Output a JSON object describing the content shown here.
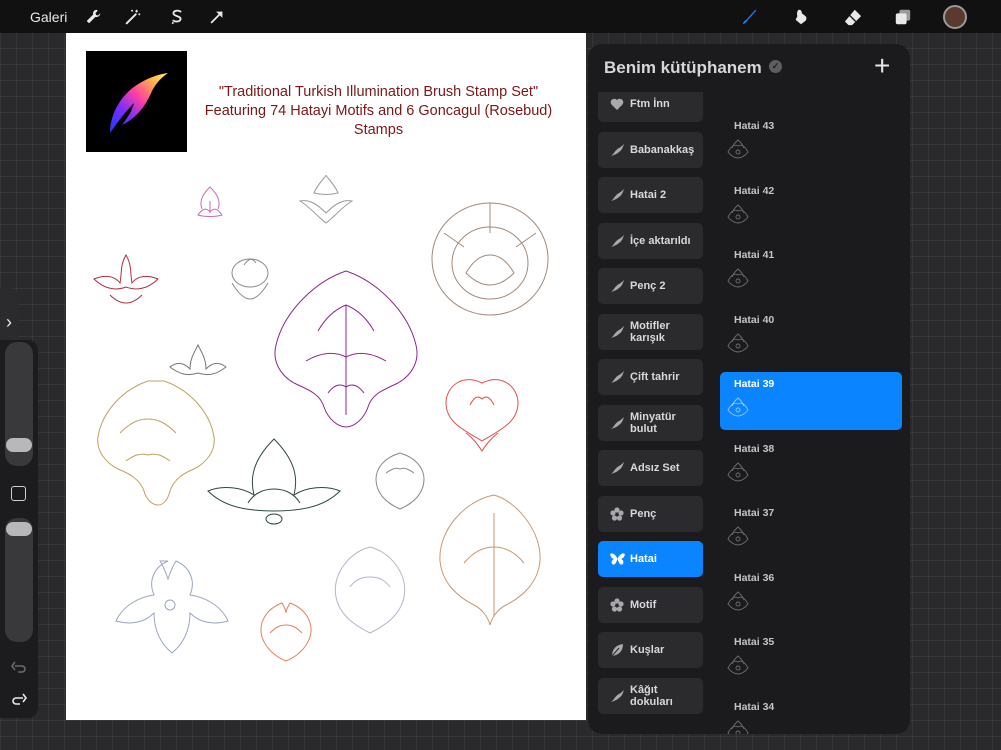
{
  "topbar": {
    "gallery_label": "Galeri",
    "left_tools": [
      "wrench-icon",
      "magic-wand-icon",
      "selection-icon",
      "transform-arrow-icon"
    ],
    "right_tools": [
      "brush-icon",
      "smudge-icon",
      "eraser-icon",
      "layers-icon"
    ],
    "current_color": "#5a3a2e",
    "active_tool_color": "#0a84ff"
  },
  "canvas": {
    "title": "\"Traditional Turkish Illumination Brush Stamp Set\" Featuring 74 Hatayi Motifs and 6 Goncagul (Rosebud) Stamps",
    "title_color": "#7b1717"
  },
  "library": {
    "title": "Benim kütüphanem",
    "add_label": "+",
    "brush_sets": [
      {
        "label": "Ftm İnn",
        "icon": "heart-icon",
        "selected": false
      },
      {
        "label": "Babanakkaş",
        "icon": "brush-stroke-icon",
        "selected": false
      },
      {
        "label": "Hatai 2",
        "icon": "brush-stroke-icon",
        "selected": false
      },
      {
        "label": "İçe aktarıldı",
        "icon": "brush-stroke-icon",
        "selected": false
      },
      {
        "label": "Penç 2",
        "icon": "brush-stroke-icon",
        "selected": false
      },
      {
        "label": "Motifler karışık",
        "icon": "brush-stroke-icon",
        "selected": false
      },
      {
        "label": "Çift tahrir",
        "icon": "brush-stroke-icon",
        "selected": false
      },
      {
        "label": "Minyatür bulut",
        "icon": "brush-stroke-icon",
        "selected": false
      },
      {
        "label": "Adsız Set",
        "icon": "brush-stroke-icon",
        "selected": false
      },
      {
        "label": "Penç",
        "icon": "flower-icon",
        "selected": false
      },
      {
        "label": "Hatai",
        "icon": "butterfly-icon",
        "selected": true
      },
      {
        "label": "Motif",
        "icon": "flower-icon",
        "selected": false
      },
      {
        "label": "Kuşlar",
        "icon": "leaf-icon",
        "selected": false
      },
      {
        "label": "Kâğıt dokuları",
        "icon": "brush-stroke-icon",
        "selected": false
      }
    ],
    "brushes": [
      {
        "label": "Hatai 43",
        "selected": false
      },
      {
        "label": "Hatai 42",
        "selected": false
      },
      {
        "label": "Hatai 41",
        "selected": false
      },
      {
        "label": "Hatai 40",
        "selected": false
      },
      {
        "label": "Hatai 39",
        "selected": true
      },
      {
        "label": "Hatai 38",
        "selected": false
      },
      {
        "label": "Hatai 37",
        "selected": false
      },
      {
        "label": "Hatai 36",
        "selected": false
      },
      {
        "label": "Hatai 35",
        "selected": false
      },
      {
        "label": "Hatai 34",
        "selected": false
      }
    ]
  }
}
